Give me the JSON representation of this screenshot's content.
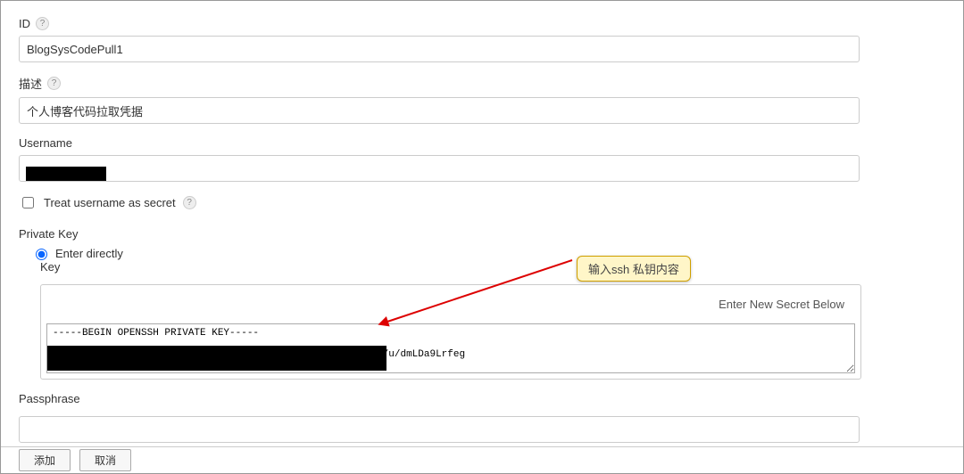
{
  "fields": {
    "id": {
      "label": "ID",
      "value": "BlogSysCodePull1"
    },
    "desc": {
      "label": "描述",
      "value": "个人博客代码拉取凭据"
    },
    "username": {
      "label": "Username",
      "value": ""
    },
    "treatSecret": {
      "label": "Treat username as secret"
    },
    "privateKey": {
      "label": "Private Key",
      "mode": "Enter directly",
      "keyLabel": "Key",
      "hint": "Enter New Secret Below",
      "content": "-----BEGIN OPENSSH PRIVATE KEY-----\n\nSwAAAAtzc2gtZWQyNTUxOQAAACDnWQ7Hxfzj4oi+c6ijLkovwiTf8Ck//u/dmLDa9Lrfeg"
    },
    "passphrase": {
      "label": "Passphrase",
      "value": ""
    }
  },
  "callout": {
    "text": "输入ssh 私钥内容"
  },
  "buttons": {
    "add": "添加",
    "cancel": "取消"
  }
}
